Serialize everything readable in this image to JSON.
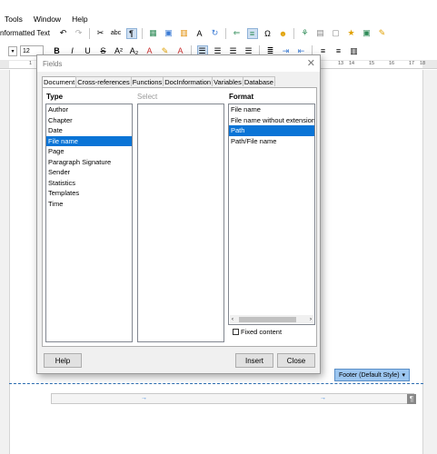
{
  "menubar": {
    "items": [
      "Tools",
      "Window",
      "Help"
    ]
  },
  "toolbar": {
    "paragraph_style": "nformatted Text",
    "font_size": "12",
    "icons": [
      "cut-icon",
      "spellcheck-icon",
      "formatting-marks-icon",
      "table-icon",
      "image-icon",
      "chart-icon",
      "textbox-icon",
      "special-char-icon",
      "autocorrect-icon"
    ]
  },
  "ruler": {
    "ticks": [
      "1",
      "13",
      "14",
      "15",
      "16",
      "17",
      "18"
    ]
  },
  "dialog": {
    "title": "Fields",
    "tabs": [
      "Document",
      "Cross-references",
      "Functions",
      "DocInformation",
      "Variables",
      "Database"
    ],
    "active_tab": "Document",
    "type_header": "Type",
    "select_header": "Select",
    "format_header": "Format",
    "type_items": [
      "Author",
      "Chapter",
      "Date",
      "File name",
      "Page",
      "Paragraph Signature",
      "Sender",
      "Statistics",
      "Templates",
      "Time"
    ],
    "type_selected": "File name",
    "format_items": [
      "File name",
      "File name without extension",
      "Path",
      "Path/File name"
    ],
    "format_selected": "Path",
    "fixed_content_label": "Fixed content",
    "fixed_content_checked": false,
    "help_label": "Help",
    "insert_label": "Insert",
    "close_label": "Close"
  },
  "document": {
    "footer_label": "Footer (Default Style)",
    "footer_dropdown_glyph": "▾",
    "pilcrow": "¶"
  }
}
